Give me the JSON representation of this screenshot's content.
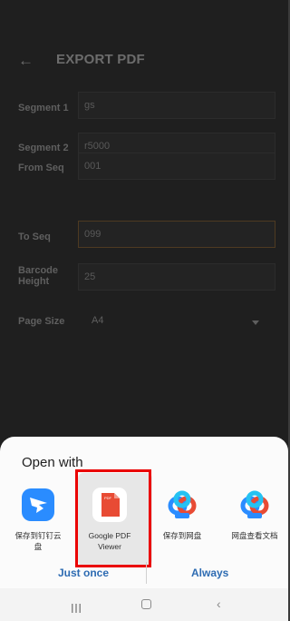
{
  "header": {
    "title": "EXPORT PDF",
    "back_icon": "arrow-left-icon"
  },
  "form": {
    "segment1_label": "Segment 1",
    "segment1_value": "gs",
    "segment2_label": "Segment 2",
    "segment2_value": "r5000",
    "from_seq_label": "From Seq",
    "from_seq_value": "001",
    "to_seq_label": "To Seq",
    "to_seq_value": "099",
    "barcode_label_line1": "Barcode",
    "barcode_label_line2": "Height",
    "barcode_value": "25",
    "page_size_label": "Page Size",
    "page_size_value": "A4"
  },
  "sheet": {
    "title": "Open with",
    "apps": [
      {
        "label_line1": "保存到钉钉云",
        "label_line2": "盘",
        "icon": "dingtalk-icon"
      },
      {
        "label_line1": "Google PDF",
        "label_line2": "Viewer",
        "icon": "pdf-icon"
      },
      {
        "label_line1": "保存到网盘",
        "label_line2": "",
        "icon": "baidu-netdisk-icon"
      },
      {
        "label_line1": "网盘查看文档",
        "label_line2": "",
        "icon": "baidu-netdisk-icon"
      }
    ],
    "just_once": "Just once",
    "always": "Always"
  },
  "colors": {
    "accent": "#2d6bb2",
    "highlight": "#ea0000",
    "pdf_red": "#e84b34",
    "dingtalk_blue": "#2a8cff"
  }
}
